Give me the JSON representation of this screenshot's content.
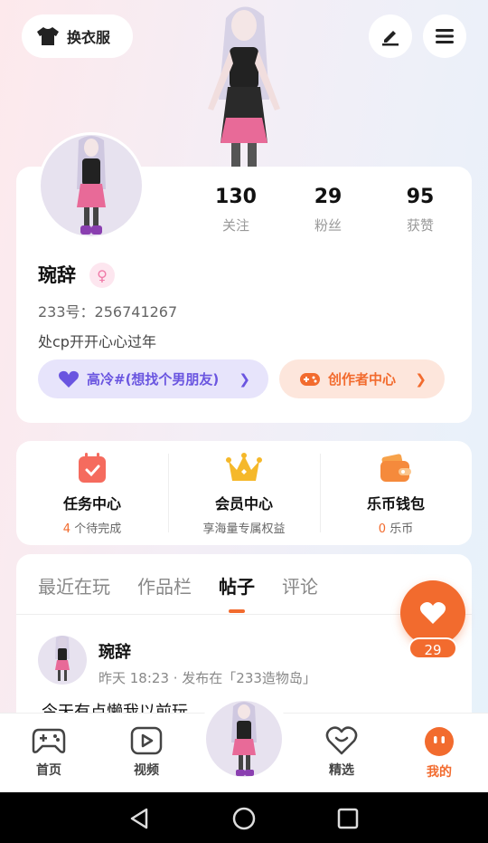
{
  "top_bar": {
    "dress_label": "换衣服"
  },
  "stats": [
    {
      "value": "130",
      "label": "关注"
    },
    {
      "value": "29",
      "label": "粉丝"
    },
    {
      "value": "95",
      "label": "获赞"
    }
  ],
  "profile": {
    "username": "琬辞",
    "uid": "233号：256741267",
    "bio": "处cp开开心心过年",
    "group_pill": "高冷#(想找个男朋友)",
    "creator_pill": "创作者中心"
  },
  "services": [
    {
      "title": "任务中心",
      "count": "4",
      "sub": " 个待完成"
    },
    {
      "title": "会员中心",
      "sub": "享海量专属权益"
    },
    {
      "title": "乐币钱包",
      "count": "0",
      "sub": " 乐币"
    }
  ],
  "tabs": [
    "最近在玩",
    "作品栏",
    "帖子",
    "评论"
  ],
  "active_tab": "帖子",
  "post": {
    "author": "琬辞",
    "meta": "昨天 18:23 · 发布在「233造物岛」",
    "text": "今天有点懒我以前玩"
  },
  "like_count": "29",
  "nav": [
    "首页",
    "视频",
    "精选",
    "我的"
  ],
  "colors": {
    "accent": "#f26b2e",
    "purple": "#6a55e0",
    "active_nav": "#f26b2e"
  }
}
